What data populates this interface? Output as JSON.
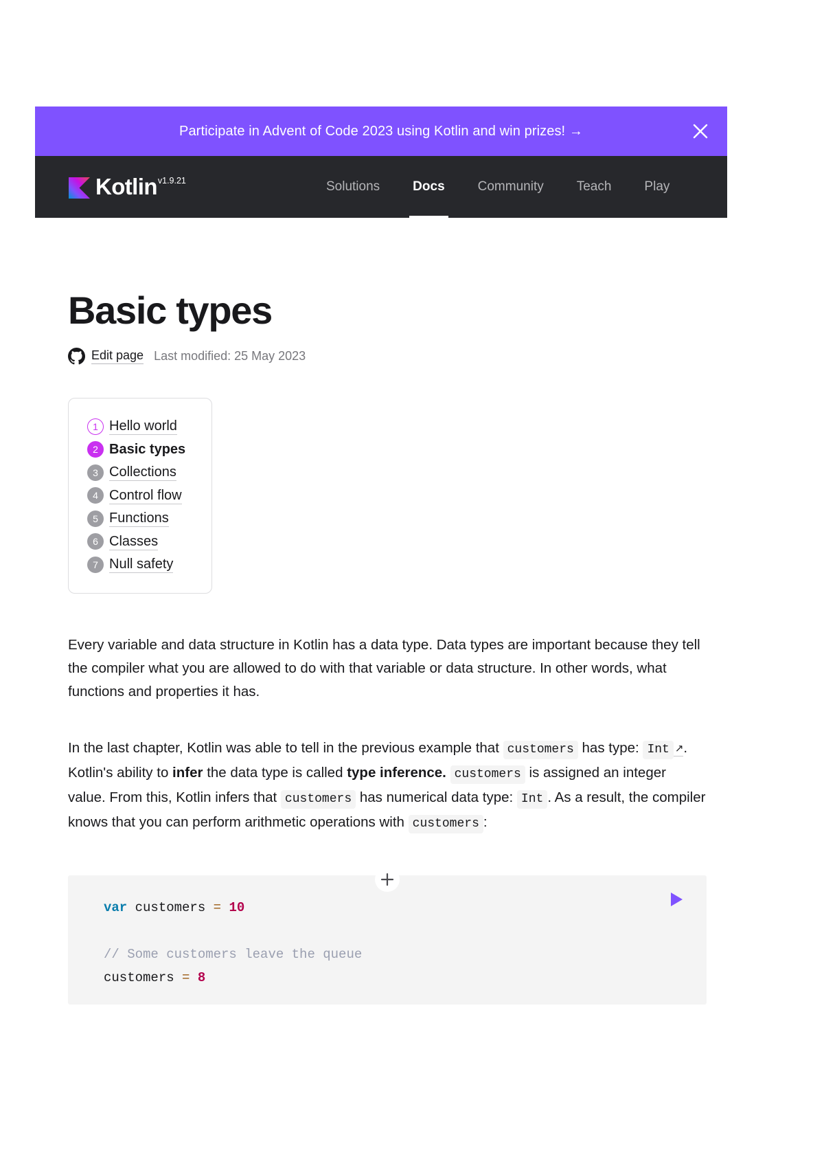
{
  "banner": {
    "text": "Participate in Advent of Code 2023 using Kotlin and win prizes! →",
    "close_label": "×",
    "color": "#7F52FF"
  },
  "nav": {
    "brand_name": "Kotlin",
    "version": "v1.9.21",
    "links": [
      {
        "label": "Solutions",
        "active": false
      },
      {
        "label": "Docs",
        "active": true
      },
      {
        "label": "Community",
        "active": false
      },
      {
        "label": "Teach",
        "active": false
      },
      {
        "label": "Play",
        "active": false
      }
    ],
    "background": "#27282C"
  },
  "article": {
    "title": "Basic types",
    "edit_link": "Edit page",
    "last_modified": "Last modified: 25 May 2023"
  },
  "tour": {
    "items": [
      {
        "number": "1",
        "label": "Hello world",
        "state": "visited"
      },
      {
        "number": "2",
        "label": "Basic types",
        "state": "current"
      },
      {
        "number": "3",
        "label": "Collections",
        "state": "default"
      },
      {
        "number": "4",
        "label": "Control flow",
        "state": "default"
      },
      {
        "number": "5",
        "label": "Functions",
        "state": "default"
      },
      {
        "number": "6",
        "label": "Classes",
        "state": "default"
      },
      {
        "number": "7",
        "label": "Null safety",
        "state": "default"
      }
    ],
    "accent": "#C930F0",
    "muted": "#9E9EA3"
  },
  "paragraphs": {
    "p1": "Every variable and data structure in Kotlin has a data type. Data types are important because they tell the compiler what you are allowed to do with that variable or data structure. In other words, what functions and properties it has.",
    "p2_a": "In the last chapter, Kotlin was able to tell in the previous example that",
    "p2_code1": "customers",
    "p2_b": "has type:",
    "p2_link": "Int",
    "p2_link_arrow": "↗",
    "p2_c": ". Kotlin's ability to",
    "p2_bold1": "infer",
    "p2_d": "the data type is called",
    "p2_bold2": "type inference.",
    "p2_code2": "customers",
    "p2_e": "is assigned an integer value. From this, Kotlin infers that",
    "p2_code3": "customers",
    "p2_f": "has numerical data type:",
    "p2_code4": "Int",
    "p2_g": ". As a result, the compiler knows that you can perform arithmetic operations with",
    "p2_code5": "customers",
    "p2_h": ":"
  },
  "code": {
    "expand_icon": "plus-icon",
    "run_icon": "play-icon",
    "lines": [
      {
        "kind": "code",
        "tokens": [
          {
            "t": "var",
            "c": "kw"
          },
          {
            "t": " customers ",
            "c": "plain"
          },
          {
            "t": "=",
            "c": "op"
          },
          {
            "t": " ",
            "c": "plain"
          },
          {
            "t": "10",
            "c": "num"
          }
        ]
      },
      {
        "kind": "blank",
        "tokens": []
      },
      {
        "kind": "code",
        "tokens": [
          {
            "t": "// Some customers leave the queue",
            "c": "com"
          }
        ]
      },
      {
        "kind": "code",
        "tokens": [
          {
            "t": "customers ",
            "c": "plain"
          },
          {
            "t": "=",
            "c": "op"
          },
          {
            "t": " ",
            "c": "plain"
          },
          {
            "t": "8",
            "c": "num"
          }
        ]
      }
    ]
  }
}
